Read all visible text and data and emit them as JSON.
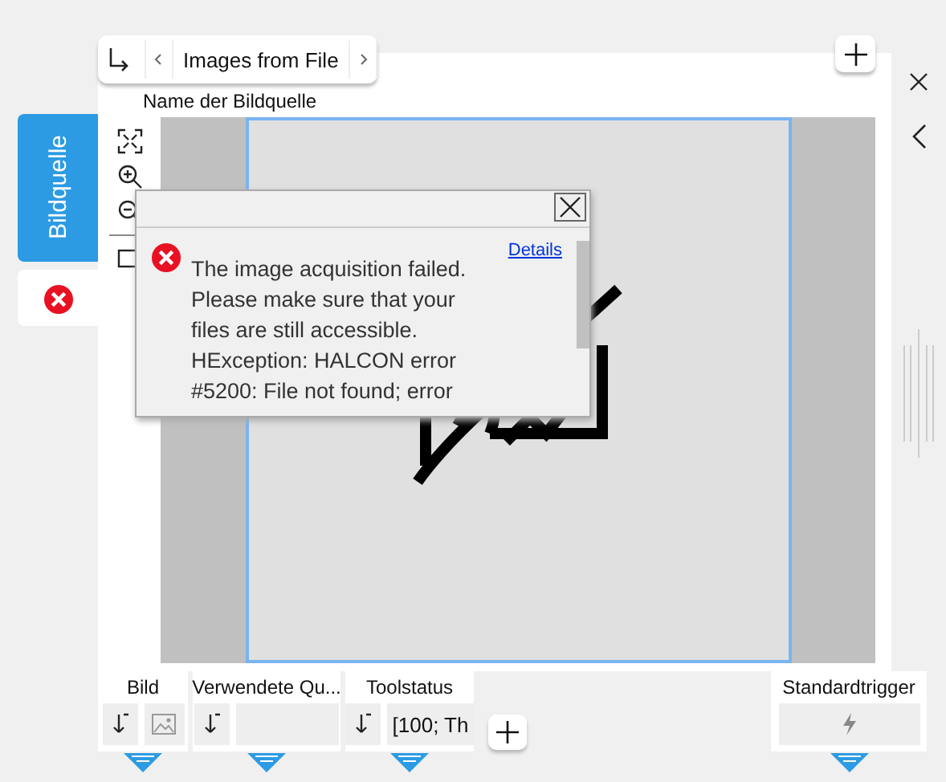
{
  "breadcrumb": {
    "label": "Images from File"
  },
  "source_label": "Name der Bildquelle",
  "side_tabs": [
    {
      "kind": "label",
      "label": "Bildquelle",
      "selected": true
    },
    {
      "kind": "error",
      "selected": false
    }
  ],
  "dialog": {
    "message": "The image acquisition failed. Please make sure that your files are still accessible. HException: HALCON error #5200: File not found; error",
    "link": "Details"
  },
  "ports": [
    {
      "label": "Bild",
      "kind": "image"
    },
    {
      "label": "Verwendete Qu...",
      "kind": "empty"
    },
    {
      "label": "Toolstatus",
      "kind": "text",
      "value": "[100; Th"
    },
    {
      "label": "Standardtrigger",
      "kind": "trigger"
    }
  ]
}
